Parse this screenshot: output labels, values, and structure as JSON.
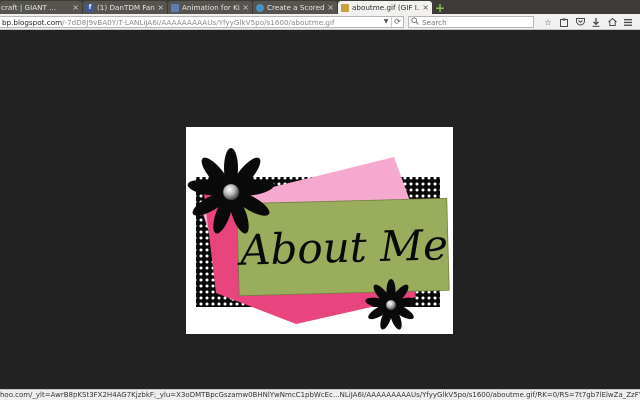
{
  "tabs": [
    {
      "label": "craft | GIANT ...",
      "favicon_color": "#f0a830"
    },
    {
      "label": "(1) DanTDM Fans",
      "favicon_color": "#3b5998"
    },
    {
      "label": "Animation for Kid...",
      "favicon_color": "#5b7fb5"
    },
    {
      "label": "Create a Scored Q...",
      "favicon_color": "#4a90c0"
    },
    {
      "label": "aboutme.gif (GIF I...",
      "favicon_color": "#c8a040",
      "active": true
    }
  ],
  "close_glyph": "×",
  "newtab_glyph": "+",
  "urlbar": {
    "host": "bp.blogspot.com",
    "path": "/-7dD8J9vBA0Y/T-LANLiJA6I/AAAAAAAAAUs/YfyyGlkV5po/s1600/aboutme.gif"
  },
  "search": {
    "placeholder": "Search"
  },
  "image": {
    "title_line": "About Me",
    "colors": {
      "pink_light": "#f6a9cf",
      "pink_hot": "#e8457f",
      "green": "#9aad5c",
      "black": "#0a0a0a"
    }
  },
  "status": {
    "text": "hoo.com/_ylt=AwrB8pKSt3FX2H4AG7KjzbkF;_ylu=X3oDMTBpcGszamw0BHNlYwNmcC1pbWcEc...NLiJA6I/AAAAAAAAAUs/YfyyGlkV5po/s1600/aboutme.gif/RK=0/RS=7t7gb7lElwZa_ZzFYDDaD"
  }
}
